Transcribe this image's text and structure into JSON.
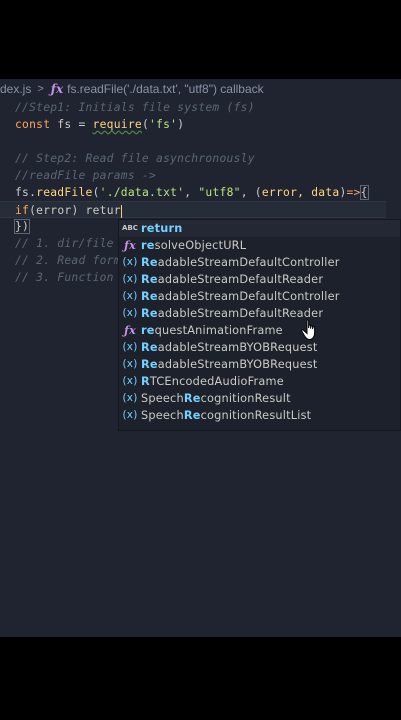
{
  "breadcrumb": {
    "file": "dex.js",
    "separator": ">",
    "symbol_icon": "ƒx",
    "symbol": "fs.readFile('./data.txt', \"utf8\") callback"
  },
  "code": {
    "line1": "//Step1: Initials file system (fs)",
    "line2": {
      "kw": "const",
      "rest1": " fs = ",
      "fn": "require",
      "p1": "(",
      "str": "'fs'",
      "p2": ")"
    },
    "line4": "// Step2: Read file asynchronously",
    "line5": "//readFile params ->",
    "line6": {
      "obj": "fs.",
      "fn": "readFile",
      "p1": "(",
      "s1": "'./data.txt'",
      "c1": ", ",
      "s2": "\"utf8\"",
      "c2": ", ",
      "p2": "(",
      "args": "error, data",
      "p3": ")",
      "arrow": "=>",
      "brace": "{"
    },
    "line7": {
      "kw": "if",
      "p1": "(",
      "arg": "error",
      "p2": ")",
      "typed": " retur"
    },
    "line8": "})",
    "line9": "// 1. dir/file",
    "line10": "// 2. Read form",
    "line11": "// 3. Function"
  },
  "suggestions": [
    {
      "icon": "ABC",
      "pre": "",
      "match": "return",
      "post": ""
    },
    {
      "icon": "ƒx",
      "pre": "",
      "match": "re",
      "post": "solveObjectURL"
    },
    {
      "icon": "(x)",
      "pre": "",
      "match": "Re",
      "post": "adableStreamDefaultController"
    },
    {
      "icon": "(x)",
      "pre": "",
      "match": "Re",
      "post": "adableStreamDefaultReader"
    },
    {
      "icon": "(x)",
      "pre": "",
      "match": "Re",
      "post": "adableStreamDefaultController"
    },
    {
      "icon": "(x)",
      "pre": "",
      "match": "Re",
      "post": "adableStreamDefaultReader"
    },
    {
      "icon": "ƒx",
      "pre": "",
      "match": "re",
      "post": "questAnimationFrame"
    },
    {
      "icon": "(x)",
      "pre": "",
      "match": "Re",
      "post": "adableStreamBYOBRequest"
    },
    {
      "icon": "(x)",
      "pre": "",
      "match": "Re",
      "post": "adableStreamBYOBRequest"
    },
    {
      "icon": "(x)",
      "pre": "",
      "match": "R",
      "post": "TCEncodedAudioFrame"
    },
    {
      "icon": "(x)",
      "pre": "Speech",
      "match": "Re",
      "post": "cognitionResult"
    },
    {
      "icon": "(x)",
      "pre": "Speech",
      "match": "Re",
      "post": "cognitionResultList"
    }
  ],
  "colors": {
    "editor_bg": "#1f2430",
    "comment": "#5c6773",
    "keyword": "#ffa759",
    "function": "#ffd580",
    "string": "#bae67e",
    "match_highlight": "#73d0ff",
    "function_icon": "#c792ea"
  }
}
